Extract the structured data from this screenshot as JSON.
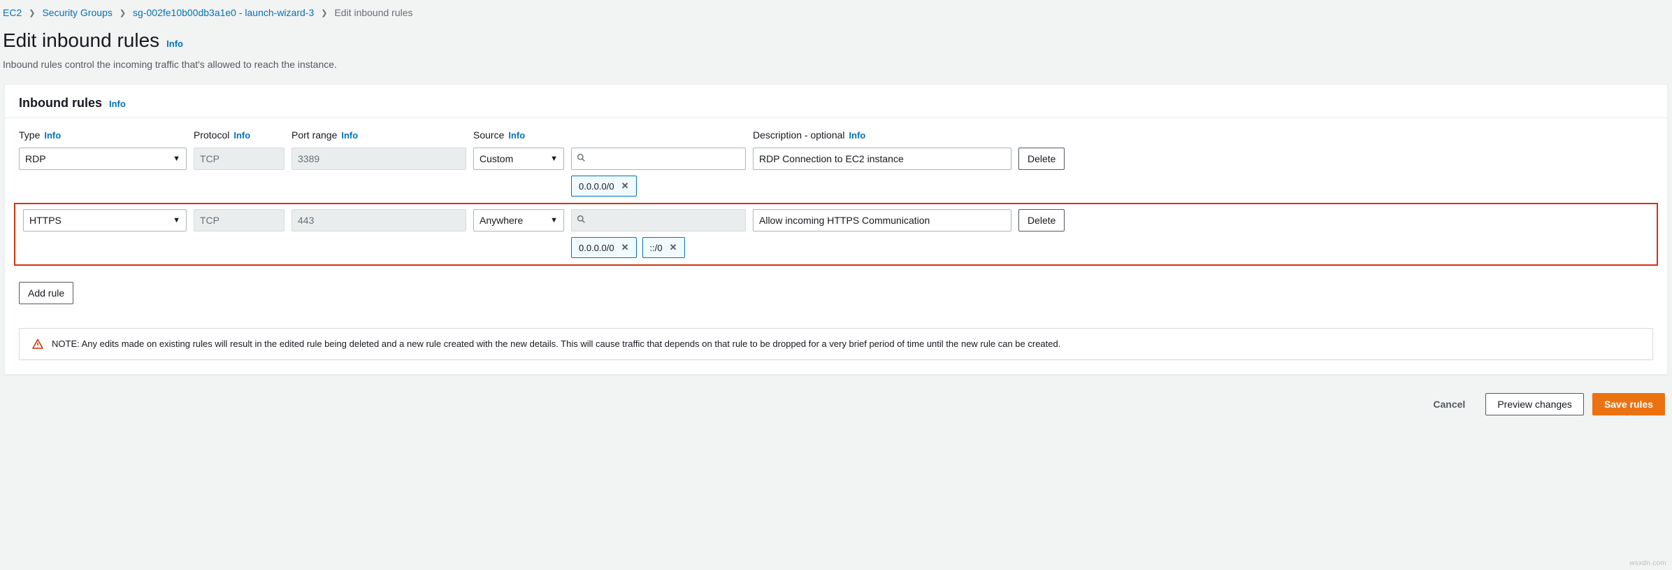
{
  "breadcrumb": {
    "ec2": "EC2",
    "security_groups": "Security Groups",
    "sg_label": "sg-002fe10b00db3a1e0 - launch-wizard-3",
    "current": "Edit inbound rules"
  },
  "page": {
    "title": "Edit inbound rules",
    "info": "Info",
    "subtitle": "Inbound rules control the incoming traffic that's allowed to reach the instance."
  },
  "panel": {
    "title": "Inbound rules",
    "info": "Info"
  },
  "columns": {
    "type": "Type",
    "protocol": "Protocol",
    "port": "Port range",
    "source": "Source",
    "description": "Description - optional",
    "info": "Info"
  },
  "rules": [
    {
      "type": "RDP",
      "protocol": "TCP",
      "port": "3389",
      "source_mode": "Custom",
      "source_search_disabled": false,
      "cidrs": [
        "0.0.0.0/0"
      ],
      "description": "RDP Connection to EC2 instance",
      "highlighted": false
    },
    {
      "type": "HTTPS",
      "protocol": "TCP",
      "port": "443",
      "source_mode": "Anywhere",
      "source_search_disabled": true,
      "cidrs": [
        "0.0.0.0/0",
        "::/0"
      ],
      "description": "Allow incoming HTTPS Communication",
      "highlighted": true
    }
  ],
  "buttons": {
    "delete": "Delete",
    "add_rule": "Add rule",
    "cancel": "Cancel",
    "preview": "Preview changes",
    "save": "Save rules"
  },
  "note": "NOTE: Any edits made on existing rules will result in the edited rule being deleted and a new rule created with the new details. This will cause traffic that depends on that rule to be dropped for a very brief period of time until the new rule can be created.",
  "watermark": "wsxdn.com"
}
